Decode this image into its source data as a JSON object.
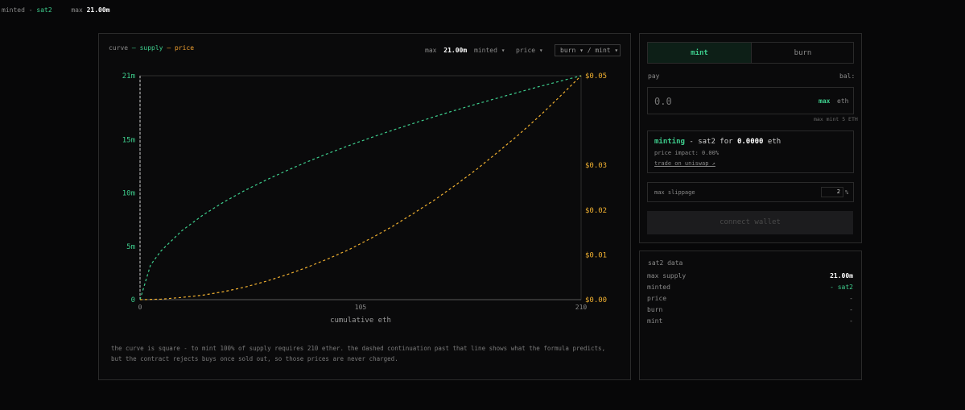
{
  "topbar": {
    "minted_label": "minted",
    "dash": "-",
    "token": "sat2",
    "max_label": "max",
    "max_value": "21.00m"
  },
  "chart_panel": {
    "legend": {
      "curve": "curve",
      "dash1": "—",
      "supply": "supply",
      "dash2": "—",
      "price": "price"
    },
    "controls": {
      "max_label": "max",
      "max_value": "21.00m",
      "minted": "minted ▾",
      "price": "price ▾",
      "burn_mint": "burn ▾ / mint ▾"
    },
    "note": "the curve is square - to mint 100% of supply requires 210 ether. the dashed continuation past that line shows what the formula predicts, but the contract rejects buys once sold out, so those prices are never charged."
  },
  "chart_data": {
    "type": "line",
    "xlabel": "cumulative eth",
    "x_ticks": [
      "0",
      "105",
      "210"
    ],
    "xlim": [
      0,
      210
    ],
    "y_left_ticks": [
      "0",
      "5m",
      "10m",
      "15m",
      "21m"
    ],
    "y_left_lim": [
      0,
      21
    ],
    "y_right_ticks": [
      "$0.00",
      "$0.01",
      "$0.02",
      "$0.03",
      "$0.05"
    ],
    "y_right_lim": [
      0,
      0.05
    ],
    "grid": false,
    "series": [
      {
        "color": "#3ecf8e",
        "axis": "left",
        "x": [
          0,
          5,
          10,
          20,
          30,
          40,
          50,
          60,
          70,
          80,
          90,
          100,
          105,
          110,
          120,
          130,
          140,
          150,
          160,
          170,
          180,
          190,
          200,
          210
        ],
        "values": [
          0,
          3.24,
          4.58,
          6.48,
          7.94,
          9.17,
          10.25,
          11.22,
          12.12,
          12.96,
          13.75,
          14.49,
          14.85,
          15.2,
          15.87,
          16.52,
          17.15,
          17.75,
          18.33,
          18.89,
          19.44,
          19.98,
          20.49,
          21.0
        ]
      },
      {
        "color": "#f0b030",
        "axis": "right",
        "x": [
          0,
          10,
          20,
          30,
          40,
          50,
          60,
          70,
          80,
          90,
          100,
          105,
          110,
          120,
          130,
          140,
          150,
          160,
          170,
          180,
          190,
          200,
          210
        ],
        "values": [
          0,
          0.0001,
          0.0005,
          0.001,
          0.0018,
          0.0028,
          0.0041,
          0.0056,
          0.0073,
          0.0092,
          0.0113,
          0.0125,
          0.0137,
          0.0163,
          0.0192,
          0.0222,
          0.0255,
          0.029,
          0.0328,
          0.0367,
          0.0409,
          0.0454,
          0.05
        ]
      }
    ]
  },
  "trade": {
    "tab_mint": "mint",
    "tab_burn": "burn",
    "pay_label": "pay",
    "bal_label": "bal:",
    "amount_placeholder": "0.0",
    "max_btn": "max",
    "unit": "eth",
    "max_mint_note": "max mint 5 ETH",
    "summary_title": "minting",
    "summary_rest": "- sat2 for",
    "summary_amount": "0.0000",
    "summary_unit": "eth",
    "price_impact": "price impact: 0.00%",
    "uniswap_link": "trade on uniswap ↗",
    "slippage_label": "max slippage",
    "slippage_value": "2",
    "slippage_unit": "%",
    "connect": "connect wallet"
  },
  "data_panel": {
    "title": "sat2 data",
    "rows": [
      {
        "label": "max supply",
        "value": "21.00m"
      },
      {
        "label": "minted",
        "value": "- sat2"
      },
      {
        "label": "price",
        "value": "-"
      },
      {
        "label": "burn",
        "value": "-"
      },
      {
        "label": "mint",
        "value": "-"
      }
    ]
  },
  "colors": {
    "supply": "#3ecf8e",
    "price": "#f0b030",
    "background": "#070708",
    "border": "#2a2a2a"
  }
}
